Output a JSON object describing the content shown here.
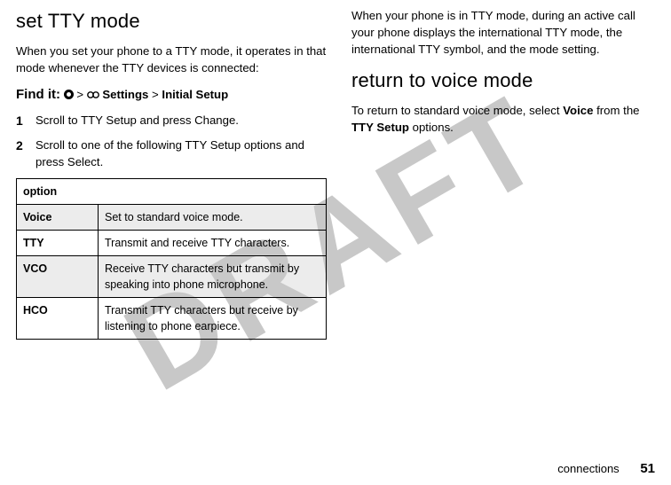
{
  "watermark": "DRAFT",
  "left": {
    "heading": "set TTY mode",
    "intro": "When you set your phone to a TTY mode, it operates in that mode whenever the TTY devices is connected:",
    "findit_label": "Find it:",
    "findit_sep1": " > ",
    "findit_settings": "Settings",
    "findit_sep2": " > ",
    "findit_initial": "Initial Setup",
    "steps": [
      {
        "num": "1",
        "text": "Scroll to TTY Setup and press Change."
      },
      {
        "num": "2",
        "text": "Scroll to one of the following TTY Setup options and press Select."
      }
    ],
    "table_header": "option",
    "rows": [
      {
        "key": "Voice",
        "desc": "Set to standard voice mode."
      },
      {
        "key": "TTY",
        "desc": "Transmit and receive TTY characters."
      },
      {
        "key": "VCO",
        "desc": "Receive TTY characters but transmit by speaking into phone microphone."
      },
      {
        "key": "HCO",
        "desc": "Transmit TTY characters but receive by listening to phone earpiece."
      }
    ]
  },
  "right": {
    "para1": "When your phone is in TTY mode, during an active call your phone displays the international TTY mode, the international TTY symbol, and the mode setting.",
    "heading2": "return to voice mode",
    "para2a": "To return to standard voice mode, select ",
    "para2_voice": "Voice",
    "para2b": " from the ",
    "para2_tty": "TTY Setup",
    "para2c": " options."
  },
  "footer": {
    "section": "connections",
    "page": "51"
  }
}
